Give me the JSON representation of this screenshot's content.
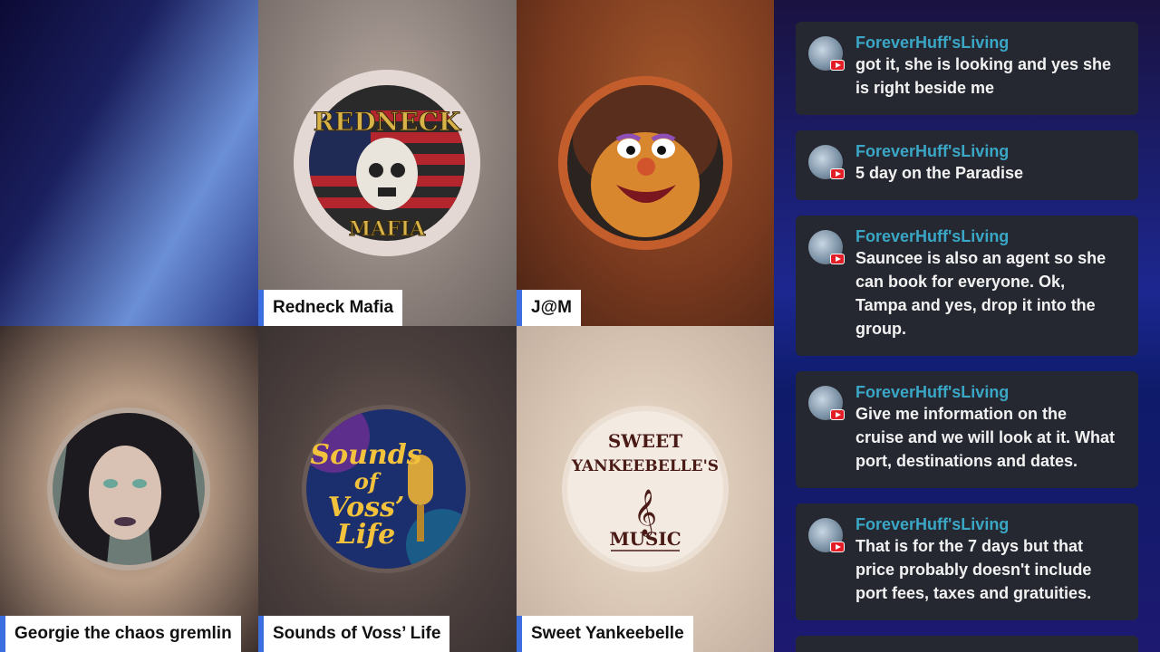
{
  "participants": [
    {
      "name": "",
      "logo_text": ""
    },
    {
      "name": "Redneck Mafia",
      "logo_top": "REDNECK",
      "logo_bottom": "MAFIA"
    },
    {
      "name": "J@M",
      "logo_text": ""
    },
    {
      "name": "Georgie the chaos gremlin",
      "logo_text": ""
    },
    {
      "name": "Sounds of Voss’ Life",
      "logo_line1": "Sounds",
      "logo_line2": "of",
      "logo_line3": "Voss’",
      "logo_line4": "Life"
    },
    {
      "name": "Sweet Yankeebelle",
      "logo_line1": "SWEET",
      "logo_line2": "YANKEEBELLE'S",
      "logo_line3": "MUSIC"
    }
  ],
  "chat": {
    "messages": [
      {
        "author": "ForeverHuff'sLiving",
        "lines": [
          "got it, she is looking and yes she",
          "is right beside me"
        ]
      },
      {
        "author": "ForeverHuff'sLiving",
        "lines": [
          "5 day on the Paradise"
        ]
      },
      {
        "author": "ForeverHuff'sLiving",
        "lines": [
          "Sauncee is also an agent so she",
          "can book for everyone. Ok,",
          "Tampa and yes, drop it into the",
          "group."
        ]
      },
      {
        "author": "ForeverHuff'sLiving",
        "lines": [
          "Give me information on the",
          "cruise and we will look at it. What",
          "port, destinations and dates."
        ]
      },
      {
        "author": "ForeverHuff'sLiving",
        "lines": [
          "That is for the 7 days but that",
          "price probably doesn't include",
          "port fees, taxes and gratuities."
        ]
      }
    ],
    "platform_icon": "youtube-icon"
  },
  "colors": {
    "accent": "#3b6fe0",
    "author": "#3aa7c6",
    "youtube": "#e41e26"
  }
}
